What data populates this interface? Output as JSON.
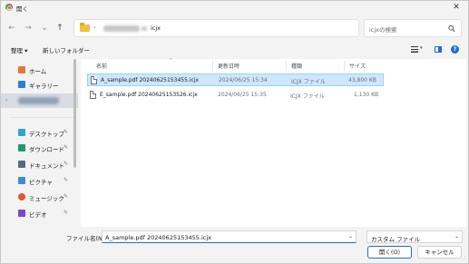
{
  "window": {
    "title": "開く"
  },
  "nav": {
    "back": "←",
    "forward": "→",
    "recent": "⌄",
    "up": "↑"
  },
  "address": {
    "separator": "›",
    "current": "icjx",
    "chevron": "⌄",
    "refresh": "↻"
  },
  "search": {
    "placeholder": "icjxの検索"
  },
  "toolbar": {
    "organize": "整理 ▾",
    "new_folder": "新しいフォルダー"
  },
  "sidebar": {
    "items": [
      {
        "label": "ホーム",
        "icon": "home-icon",
        "color": "#e07a3a",
        "pinned": false
      },
      {
        "label": "ギャラリー",
        "icon": "gallery-icon",
        "color": "#2b7fd6",
        "pinned": false
      },
      {
        "label": "",
        "icon": "onedrive-icon",
        "color": "#8fa0b8",
        "pinned": false,
        "blurred": true
      },
      {
        "label": "デスクトップ",
        "icon": "desktop-icon",
        "color": "#2ea4d8",
        "pinned": true
      },
      {
        "label": "ダウンロード",
        "icon": "download-icon",
        "color": "#1d9a6c",
        "pinned": true
      },
      {
        "label": "ドキュメント",
        "icon": "documents-icon",
        "color": "#5a6a7a",
        "pinned": true
      },
      {
        "label": "ピクチャ",
        "icon": "pictures-icon",
        "color": "#3a8ed9",
        "pinned": true
      },
      {
        "label": "ミュージック",
        "icon": "music-icon",
        "color": "#e2572b",
        "pinned": true
      },
      {
        "label": "ビデオ",
        "icon": "videos-icon",
        "color": "#7a49c8",
        "pinned": true
      }
    ],
    "pin_glyph": "📌",
    "expand_glyph": "›"
  },
  "columns": [
    "名前",
    "更新日時",
    "種類",
    "サイズ"
  ],
  "files": [
    {
      "name": "A_sample.pdf 20240625153455.icjx",
      "modified": "2024/06/25 15:34",
      "type": "ICJX ファイル",
      "size": "43,800 KB",
      "selected": true
    },
    {
      "name": "E_sample.pdf 20240625153526.icjx",
      "modified": "2024/06/25 15:35",
      "type": "ICJX ファイル",
      "size": "1,130 KB",
      "selected": false
    }
  ],
  "footer": {
    "filename_label": "ファイル名(N):",
    "filename_value": "A_sample.pdf 20240625153455.icjx",
    "filetype": "カスタム ファイル",
    "open": "開く(O)",
    "cancel": "キャンセル"
  },
  "colors": {
    "accent": "#1e6fd0",
    "selection": "#cce8ff",
    "selection_border": "#99d1ff",
    "folder": "#f0c040"
  }
}
